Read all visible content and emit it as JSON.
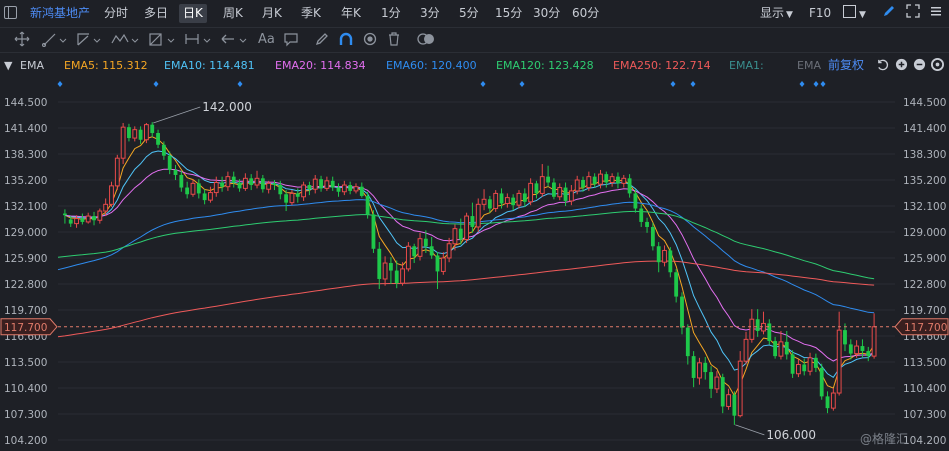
{
  "header": {
    "stock_name": "新鸿基地产",
    "periods": [
      {
        "label": "分时",
        "active": false
      },
      {
        "label": "多日",
        "active": false
      },
      {
        "label": "日K",
        "active": true
      },
      {
        "label": "周K",
        "active": false
      },
      {
        "label": "月K",
        "active": false
      },
      {
        "label": "季K",
        "active": false
      },
      {
        "label": "年K",
        "active": false
      },
      {
        "label": "1分",
        "active": false
      },
      {
        "label": "3分",
        "active": false
      },
      {
        "label": "5分",
        "active": false
      },
      {
        "label": "15分",
        "active": false
      },
      {
        "label": "30分",
        "active": false
      },
      {
        "label": "60分",
        "active": false
      }
    ],
    "display_label": "显示",
    "f10_label": "F10"
  },
  "toolbar": {
    "font_tool_label": "Aa",
    "tools": [
      "move-icon",
      "line-tool-icon",
      "polyline-tool-icon",
      "wave-tool-icon",
      "measure-tool-icon",
      "range-tool-icon",
      "arrow-tool-icon",
      "text-tool-icon",
      "comment-tool-icon",
      "pen-icon",
      "magnet-icon",
      "eye-icon",
      "trash-icon",
      "toggle-icon"
    ]
  },
  "indicators": {
    "main_label": "EMA",
    "items": [
      {
        "label": "EMA5: 115.312",
        "color": "#f5a623"
      },
      {
        "label": "EMA10: 114.481",
        "color": "#4fc3f7"
      },
      {
        "label": "EMA20: 114.834",
        "color": "#e36ff0"
      },
      {
        "label": "EMA60: 120.400",
        "color": "#2f8cf0"
      },
      {
        "label": "EMA120: 123.428",
        "color": "#2ecc71"
      },
      {
        "label": "EMA250: 122.714",
        "color": "#ef5a5a"
      },
      {
        "label": "EMA1:",
        "color": "#3a8f8f"
      },
      {
        "label": "EMA",
        "color": "#6b6f78"
      }
    ],
    "adjust_label": "前复权"
  },
  "chart_data": {
    "type": "candlestick",
    "y_ticks": [
      "144.500",
      "141.400",
      "138.300",
      "135.200",
      "132.100",
      "129.000",
      "125.900",
      "122.800",
      "119.700",
      "116.600",
      "113.500",
      "110.400",
      "107.300",
      "104.200"
    ],
    "ylim": [
      104.2,
      144.5
    ],
    "current_price": "117.700",
    "annotations": [
      {
        "label": "142.000",
        "value": 142.0
      },
      {
        "label": "106.000",
        "value": 106.0
      }
    ],
    "watermark": "@格隆汇",
    "candles": [
      [
        131.2,
        131.0,
        130.0,
        131.7
      ],
      [
        130.5,
        130.0,
        129.6,
        130.9
      ],
      [
        130.0,
        130.6,
        129.5,
        131.0
      ],
      [
        130.6,
        130.2,
        129.9,
        131.2
      ],
      [
        130.2,
        130.9,
        130.0,
        131.3
      ],
      [
        130.9,
        130.4,
        129.8,
        131.4
      ],
      [
        130.4,
        131.5,
        130.0,
        131.8
      ],
      [
        131.5,
        132.3,
        130.9,
        133.0
      ],
      [
        132.3,
        134.5,
        132.0,
        135.0
      ],
      [
        134.5,
        137.8,
        134.0,
        138.2
      ],
      [
        137.8,
        141.5,
        137.1,
        142.0
      ],
      [
        141.5,
        140.2,
        139.8,
        141.9
      ],
      [
        140.2,
        141.2,
        139.8,
        141.6
      ],
      [
        141.2,
        140.0,
        139.5,
        141.6
      ],
      [
        140.0,
        141.8,
        139.6,
        142.0
      ],
      [
        141.8,
        140.8,
        140.3,
        142.1
      ],
      [
        140.8,
        139.4,
        139.0,
        141.2
      ],
      [
        139.4,
        138.1,
        137.6,
        139.8
      ],
      [
        138.1,
        136.4,
        135.9,
        138.6
      ],
      [
        136.4,
        135.8,
        135.2,
        137.0
      ],
      [
        135.8,
        134.3,
        133.8,
        136.3
      ],
      [
        134.3,
        133.5,
        133.0,
        135.0
      ],
      [
        133.5,
        134.8,
        133.2,
        135.3
      ],
      [
        134.8,
        133.6,
        133.0,
        135.3
      ],
      [
        133.6,
        132.8,
        132.3,
        134.1
      ],
      [
        132.8,
        133.7,
        132.5,
        134.4
      ],
      [
        133.7,
        134.9,
        133.2,
        135.6
      ],
      [
        134.9,
        134.4,
        133.8,
        135.6
      ],
      [
        134.4,
        135.6,
        133.9,
        136.2
      ],
      [
        135.6,
        134.9,
        134.3,
        136.2
      ],
      [
        134.9,
        134.2,
        133.8,
        135.3
      ],
      [
        134.2,
        135.4,
        133.9,
        136.0
      ],
      [
        135.4,
        134.6,
        134.0,
        135.9
      ],
      [
        134.6,
        135.4,
        134.2,
        136.3
      ],
      [
        135.4,
        134.1,
        133.7,
        135.8
      ],
      [
        134.1,
        134.8,
        133.6,
        135.1
      ],
      [
        134.8,
        134.6,
        134.0,
        135.2
      ],
      [
        134.6,
        133.5,
        132.9,
        135.1
      ],
      [
        133.5,
        132.5,
        131.5,
        134.0
      ],
      [
        132.5,
        133.6,
        132.2,
        134.0
      ],
      [
        133.6,
        133.2,
        132.5,
        134.2
      ],
      [
        133.2,
        134.6,
        132.7,
        135.0
      ],
      [
        134.6,
        134.1,
        133.4,
        135.0
      ],
      [
        134.1,
        135.3,
        133.6,
        135.8
      ],
      [
        135.3,
        134.2,
        133.8,
        135.7
      ],
      [
        134.2,
        135.1,
        133.9,
        135.6
      ],
      [
        135.1,
        134.3,
        133.9,
        135.6
      ],
      [
        134.3,
        133.8,
        133.2,
        134.8
      ],
      [
        133.8,
        134.6,
        133.4,
        135.1
      ],
      [
        134.6,
        133.9,
        133.5,
        135.0
      ],
      [
        133.9,
        134.4,
        133.6,
        134.8
      ],
      [
        134.4,
        133.3,
        133.1,
        134.9
      ],
      [
        133.3,
        131.1,
        130.6,
        133.8
      ],
      [
        131.1,
        127.0,
        126.5,
        131.6
      ],
      [
        127.0,
        123.4,
        122.2,
        127.8
      ],
      [
        123.4,
        125.3,
        122.6,
        126.1
      ],
      [
        125.3,
        124.4,
        122.8,
        126.0
      ],
      [
        124.4,
        122.9,
        122.3,
        125.6
      ],
      [
        122.9,
        124.6,
        122.6,
        125.4
      ],
      [
        124.6,
        127.3,
        124.3,
        127.8
      ],
      [
        127.3,
        126.1,
        125.3,
        127.6
      ],
      [
        126.1,
        128.2,
        125.6,
        128.9
      ],
      [
        128.2,
        127.3,
        126.5,
        129.2
      ],
      [
        127.3,
        126.2,
        125.8,
        128.4
      ],
      [
        126.2,
        124.3,
        122.2,
        126.6
      ],
      [
        124.3,
        125.9,
        123.9,
        126.6
      ],
      [
        125.9,
        127.6,
        125.4,
        128.3
      ],
      [
        127.6,
        129.4,
        126.8,
        129.9
      ],
      [
        129.4,
        128.1,
        127.5,
        130.6
      ],
      [
        128.1,
        130.9,
        127.7,
        131.3
      ],
      [
        130.9,
        129.6,
        128.9,
        132.5
      ],
      [
        129.6,
        132.3,
        129.0,
        133.0
      ],
      [
        132.3,
        132.9,
        131.6,
        134.1
      ],
      [
        132.9,
        131.8,
        131.3,
        133.3
      ],
      [
        131.8,
        133.6,
        131.4,
        134.0
      ],
      [
        133.6,
        132.4,
        131.8,
        134.2
      ],
      [
        132.4,
        133.1,
        131.9,
        133.6
      ],
      [
        133.1,
        132.2,
        131.6,
        133.5
      ],
      [
        132.2,
        133.6,
        131.8,
        134.0
      ],
      [
        133.6,
        132.6,
        132.0,
        134.2
      ],
      [
        132.6,
        134.8,
        132.2,
        135.4
      ],
      [
        134.8,
        133.6,
        133.0,
        135.1
      ],
      [
        133.6,
        135.6,
        133.2,
        137.1
      ],
      [
        135.6,
        134.9,
        134.4,
        136.9
      ],
      [
        134.9,
        133.2,
        132.9,
        135.4
      ],
      [
        133.2,
        134.3,
        132.8,
        134.8
      ],
      [
        134.3,
        132.7,
        132.1,
        134.9
      ],
      [
        132.7,
        133.9,
        132.2,
        134.6
      ],
      [
        133.9,
        135.2,
        133.5,
        135.7
      ],
      [
        135.2,
        134.3,
        133.8,
        135.6
      ],
      [
        134.3,
        135.6,
        133.9,
        136.2
      ],
      [
        135.6,
        134.7,
        134.3,
        136.0
      ],
      [
        134.7,
        135.9,
        134.2,
        136.4
      ],
      [
        135.9,
        134.9,
        134.3,
        136.2
      ],
      [
        134.9,
        135.6,
        134.4,
        136.0
      ],
      [
        135.6,
        134.8,
        134.2,
        136.1
      ],
      [
        134.8,
        135.4,
        134.3,
        135.8
      ],
      [
        135.4,
        133.6,
        133.1,
        135.9
      ],
      [
        133.6,
        131.8,
        131.3,
        134.1
      ],
      [
        131.8,
        130.2,
        129.6,
        132.3
      ],
      [
        130.2,
        129.6,
        128.9,
        130.7
      ],
      [
        129.6,
        127.3,
        126.8,
        130.1
      ],
      [
        127.3,
        125.4,
        124.2,
        127.8
      ],
      [
        125.4,
        126.8,
        124.9,
        127.4
      ],
      [
        126.8,
        124.2,
        123.6,
        127.2
      ],
      [
        124.2,
        121.3,
        120.6,
        124.6
      ],
      [
        121.3,
        117.6,
        116.8,
        121.8
      ],
      [
        117.6,
        114.2,
        113.2,
        118.0
      ],
      [
        114.2,
        111.6,
        110.5,
        114.8
      ],
      [
        111.6,
        113.4,
        110.8,
        114.0
      ],
      [
        113.4,
        112.3,
        111.4,
        114.1
      ],
      [
        112.3,
        110.3,
        109.2,
        113.0
      ],
      [
        110.3,
        111.7,
        109.8,
        112.4
      ],
      [
        111.7,
        108.2,
        107.4,
        112.1
      ],
      [
        108.2,
        109.6,
        107.8,
        110.3
      ],
      [
        109.6,
        107.1,
        106.0,
        110.0
      ],
      [
        107.1,
        113.6,
        106.9,
        114.8
      ],
      [
        113.6,
        116.2,
        113.2,
        117.1
      ],
      [
        116.2,
        118.6,
        115.8,
        119.8
      ],
      [
        118.6,
        117.2,
        116.5,
        119.8
      ],
      [
        117.2,
        118.1,
        116.8,
        119.5
      ],
      [
        118.1,
        116.0,
        115.6,
        118.6
      ],
      [
        116.0,
        114.2,
        113.9,
        116.5
      ],
      [
        114.2,
        115.9,
        113.8,
        117.2
      ],
      [
        115.9,
        114.4,
        113.8,
        117.2
      ],
      [
        114.4,
        112.1,
        111.6,
        114.9
      ],
      [
        112.1,
        113.2,
        111.7,
        113.8
      ],
      [
        113.2,
        112.4,
        111.9,
        113.9
      ],
      [
        112.4,
        114.0,
        111.9,
        114.6
      ],
      [
        114.0,
        112.8,
        112.3,
        114.5
      ],
      [
        112.8,
        109.4,
        109.0,
        113.3
      ],
      [
        109.4,
        108.0,
        107.4,
        110.0
      ],
      [
        108.0,
        109.8,
        107.7,
        110.4
      ],
      [
        109.8,
        117.3,
        109.5,
        119.5
      ],
      [
        117.3,
        115.6,
        114.8,
        118.1
      ],
      [
        115.6,
        114.5,
        113.8,
        116.2
      ],
      [
        114.5,
        115.4,
        114.0,
        116.1
      ],
      [
        115.4,
        114.8,
        114.1,
        116.2
      ],
      [
        114.8,
        114.2,
        113.6,
        115.3
      ],
      [
        114.2,
        117.7,
        113.9,
        119.3
      ]
    ]
  }
}
